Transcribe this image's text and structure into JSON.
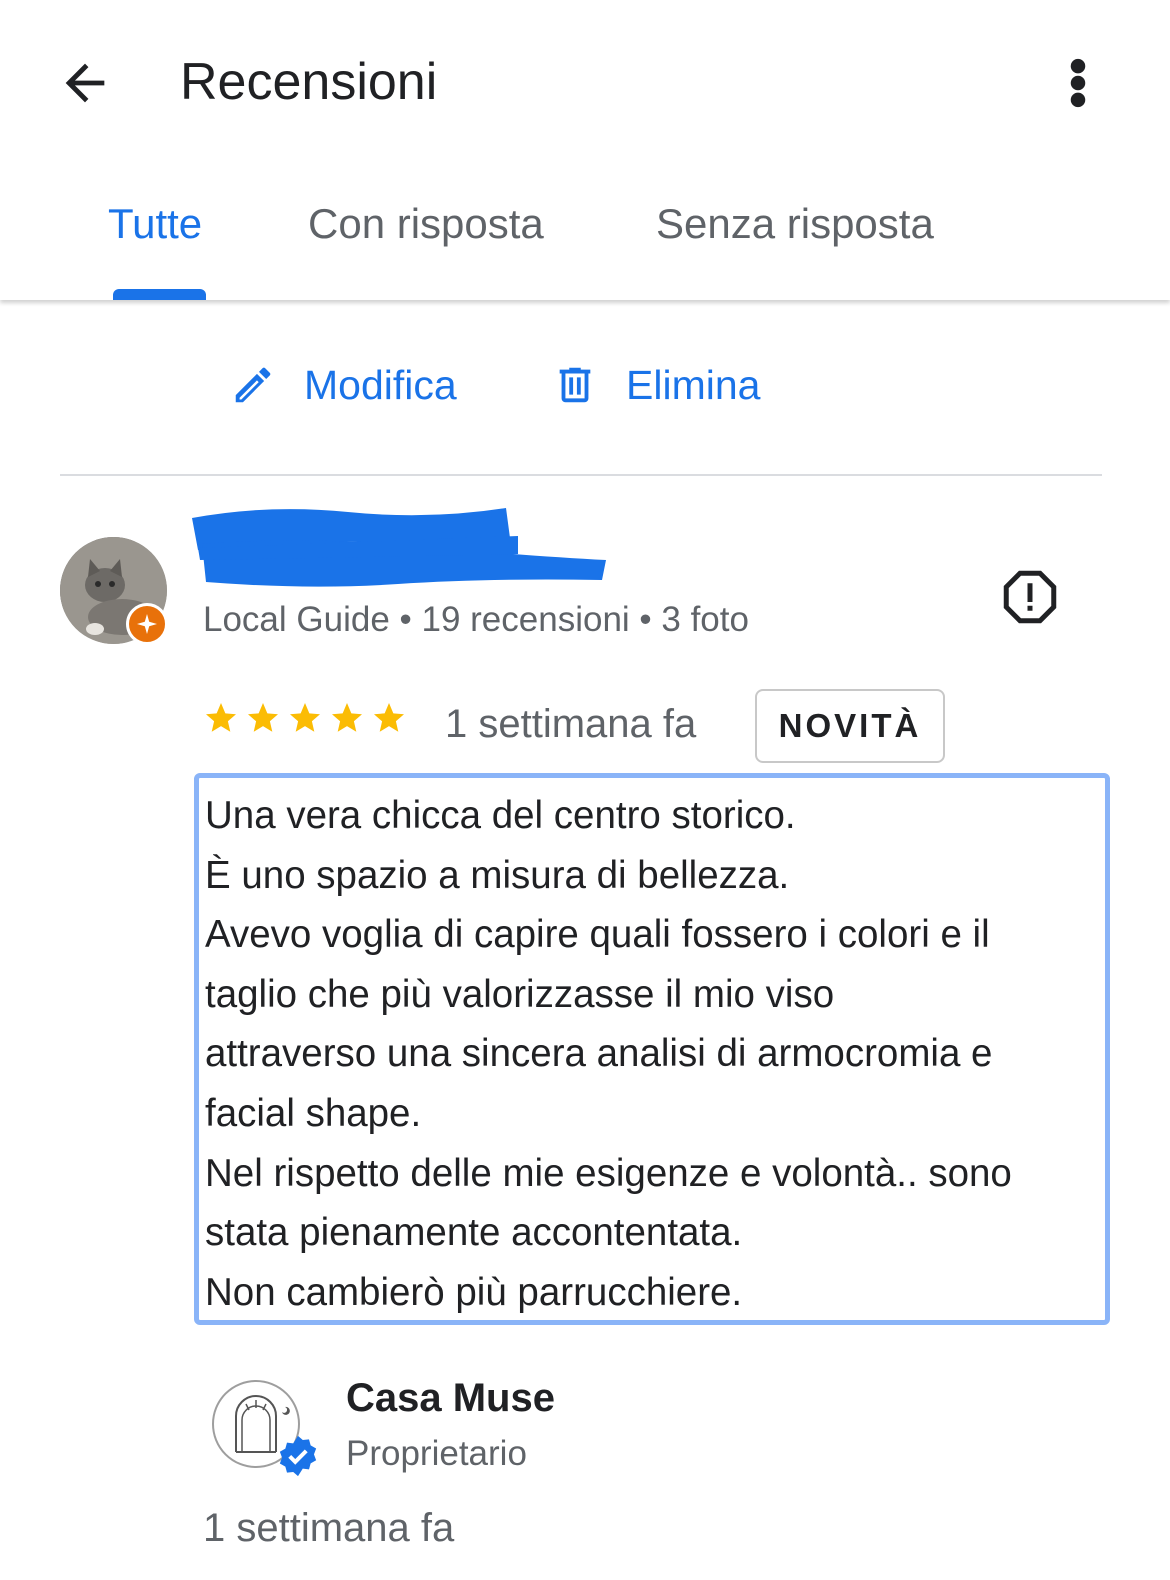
{
  "header": {
    "title": "Recensioni",
    "back_icon": "arrow-back-icon",
    "menu_icon": "more-vert-icon"
  },
  "tabs": [
    {
      "label": "Tutte",
      "active": true
    },
    {
      "label": "Con risposta",
      "active": false
    },
    {
      "label": "Senza risposta",
      "active": false
    }
  ],
  "actions": {
    "edit_label": "Modifica",
    "delete_label": "Elimina"
  },
  "review": {
    "reviewer_meta": "Local Guide • 19 recensioni • 3 foto",
    "rating": 5,
    "time": "1 settimana fa",
    "badge": "NOVITÀ",
    "text_lines": [
      "Una vera chicca del centro storico.",
      "È uno spazio a misura di bellezza.",
      "Avevo voglia di capire quali fossero i colori e il",
      "taglio che più valorizzasse il mio viso",
      "attraverso una sincera analisi di armocromia e",
      "facial shape.",
      "Nel rispetto delle mie esigenze e volontà.. sono",
      "stata pienamente accontentata.",
      "Non cambierò più parrucchiere."
    ]
  },
  "owner": {
    "name": "Casa Muse",
    "role": "Proprietario",
    "time": "1 settimana fa"
  },
  "colors": {
    "accent": "#1a73e8",
    "star": "#fbbc04",
    "local_guide": "#e8710a",
    "highlight_border": "#8ab4f8"
  }
}
